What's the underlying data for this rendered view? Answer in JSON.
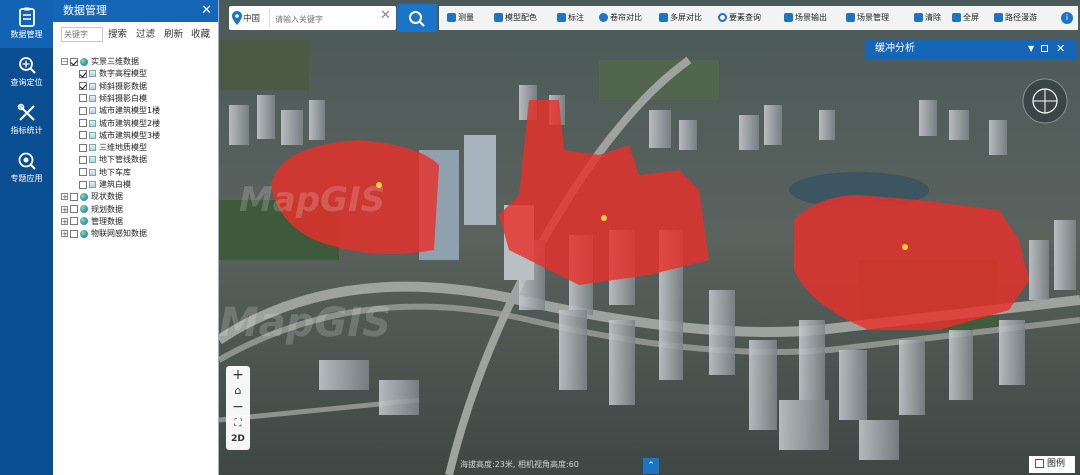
{
  "rail": {
    "items": [
      {
        "label": "数据管理",
        "icon": "clipboard-icon"
      },
      {
        "label": "查询定位",
        "icon": "search-location-icon"
      },
      {
        "label": "指标统计",
        "icon": "chart-tools-icon"
      },
      {
        "label": "专题应用",
        "icon": "magnifier-app-icon"
      }
    ]
  },
  "panel": {
    "title": "数据管理",
    "search_placeholder": "关键字",
    "tools": [
      "搜索",
      "过滤",
      "刷新",
      "收藏"
    ],
    "tree": [
      {
        "label": "实景三维数据",
        "checked": true,
        "level": 0,
        "expander": "−"
      },
      {
        "label": "数字高程模型",
        "checked": true,
        "level": 1
      },
      {
        "label": "倾斜摄影数据",
        "checked": true,
        "level": 1
      },
      {
        "label": "倾斜摄影白模",
        "checked": false,
        "level": 1
      },
      {
        "label": "城市建筑模型1楼",
        "checked": false,
        "level": 1
      },
      {
        "label": "城市建筑模型2楼",
        "checked": false,
        "level": 1
      },
      {
        "label": "城市建筑模型3楼",
        "checked": false,
        "level": 1
      },
      {
        "label": "三维地质模型",
        "checked": false,
        "level": 1
      },
      {
        "label": "地下管线数据",
        "checked": false,
        "level": 1
      },
      {
        "label": "地下车库",
        "checked": false,
        "level": 1
      },
      {
        "label": "建筑白模",
        "checked": false,
        "level": 1
      },
      {
        "label": "现状数据",
        "checked": false,
        "level": 0,
        "expander": "+"
      },
      {
        "label": "规划数据",
        "checked": false,
        "level": 0,
        "expander": "+"
      },
      {
        "label": "管理数据",
        "checked": false,
        "level": 0,
        "expander": "+"
      },
      {
        "label": "物联网感知数据",
        "checked": false,
        "level": 0,
        "expander": "+"
      }
    ]
  },
  "search": {
    "region": "中国",
    "placeholder": "请输入关键字"
  },
  "toolbar": {
    "tools": [
      {
        "label": "测量",
        "icon": "ruler-icon"
      },
      {
        "label": "模型配色",
        "icon": "paint-icon"
      },
      {
        "label": "标注",
        "icon": "flag-icon"
      },
      {
        "label": "卷帘对比",
        "icon": "globe-compare-icon"
      },
      {
        "label": "多屏对比",
        "icon": "grid-icon"
      },
      {
        "label": "要素查询",
        "icon": "search-icon"
      },
      {
        "label": "场景输出",
        "icon": "plane-icon"
      },
      {
        "label": "场景管理",
        "icon": "plane-icon"
      },
      {
        "label": "清除",
        "icon": "eraser-icon"
      },
      {
        "label": "全屏",
        "icon": "fullscreen-icon"
      },
      {
        "label": "路径漫游",
        "icon": "plane-icon"
      }
    ]
  },
  "buffer_panel": {
    "title": "缓冲分析"
  },
  "zoom": {
    "mode_label": "2D"
  },
  "status": {
    "text": "海拔高度:23米, 相机视角高度:60"
  },
  "legend": {
    "label": "图例"
  },
  "watermark": {
    "text": "MapGIS"
  },
  "colors": {
    "primary": "#1666b8",
    "rail": "#0b4f93",
    "buffer_fill": "#e8302a"
  }
}
